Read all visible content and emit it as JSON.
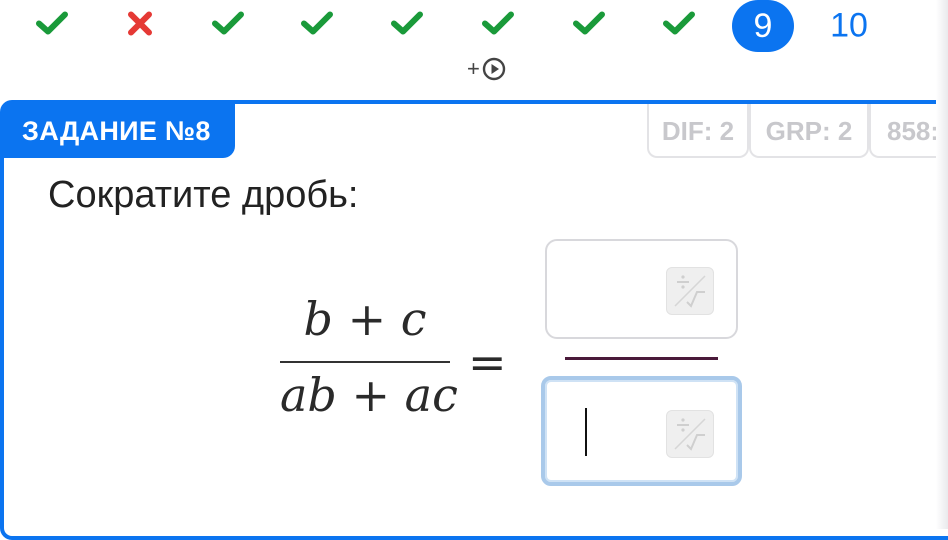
{
  "progress": {
    "items": [
      {
        "status": "correct",
        "icon": "check-icon"
      },
      {
        "status": "wrong",
        "icon": "cross-icon"
      },
      {
        "status": "correct",
        "icon": "check-icon"
      },
      {
        "status": "correct",
        "icon": "check-icon"
      },
      {
        "status": "correct",
        "icon": "check-icon"
      },
      {
        "status": "correct",
        "icon": "check-icon"
      },
      {
        "status": "correct",
        "icon": "check-icon"
      },
      {
        "status": "correct",
        "icon": "check-icon"
      },
      {
        "status": "current",
        "label": "9"
      },
      {
        "status": "pending",
        "label": "10"
      }
    ],
    "video_marker": "+",
    "colors": {
      "correct": "#1a9a3a",
      "wrong": "#e53935",
      "accent": "#0b74f0"
    }
  },
  "task": {
    "label": "ЗАДАНИЕ №8",
    "dif": "DIF: 2",
    "grp": "GRP: 2",
    "id": "858:",
    "question": "Сократите дробь:"
  },
  "math": {
    "numerator": "b + c",
    "denominator": "ab + ac",
    "equals": "="
  },
  "answer": {
    "numerator_value": "",
    "denominator_value": ""
  }
}
